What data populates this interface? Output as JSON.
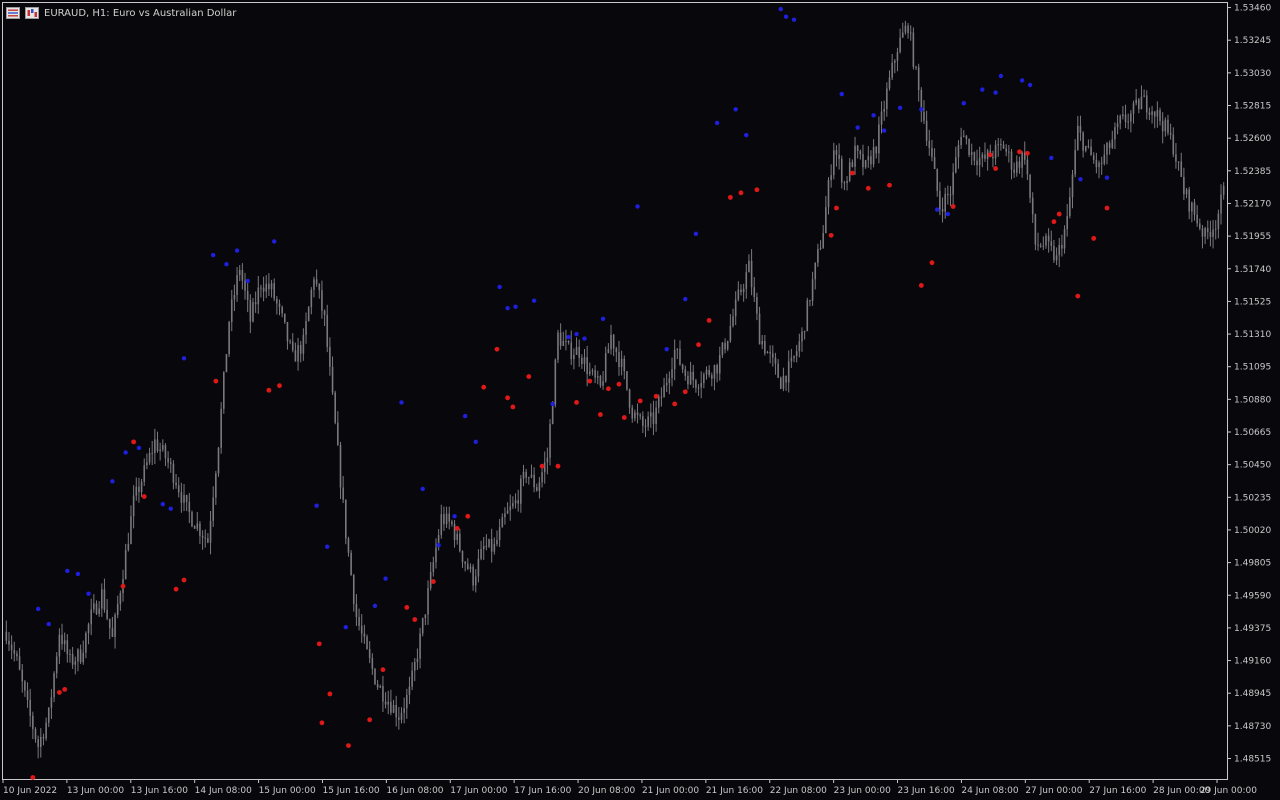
{
  "window": {
    "title": "EURAUD, H1:  Euro vs Australian Dollar",
    "icons": [
      "menu-grid-icon",
      "chart-mode-icon"
    ]
  },
  "colors": {
    "background": "#08080c",
    "candle": "#7a7a7e",
    "frame": "#c8c8c8",
    "up_marker": "#1f1fe0",
    "down_marker": "#e01818",
    "axis_text": "#c8c8c8"
  },
  "chart_data": {
    "type": "candlestick",
    "symbol": "EURAUD",
    "timeframe": "H1",
    "y_ticks": [
      "1.53460",
      "1.53245",
      "1.53030",
      "1.52815",
      "1.52600",
      "1.52385",
      "1.52170",
      "1.51955",
      "1.51740",
      "1.51525",
      "1.51310",
      "1.51095",
      "1.50880",
      "1.50665",
      "1.50450",
      "1.50235",
      "1.50020",
      "1.49805",
      "1.49590",
      "1.49375",
      "1.49160",
      "1.48945",
      "1.48730",
      "1.48515"
    ],
    "ylim": [
      1.4838,
      1.5349
    ],
    "x_ticks": [
      "10 Jun 2022",
      "13 Jun 00:00",
      "13 Jun 16:00",
      "14 Jun 08:00",
      "15 Jun 00:00",
      "15 Jun 16:00",
      "16 Jun 08:00",
      "17 Jun 00:00",
      "17 Jun 16:00",
      "20 Jun 08:00",
      "21 Jun 00:00",
      "21 Jun 16:00",
      "22 Jun 08:00",
      "23 Jun 00:00",
      "23 Jun 16:00",
      "24 Jun 08:00",
      "27 Jun 00:00",
      "27 Jun 16:00",
      "28 Jun 00:00",
      "29 Jun 00:00"
    ],
    "price_path": [
      [
        0,
        1.4935
      ],
      [
        4,
        1.4915
      ],
      [
        8,
        1.4885
      ],
      [
        12,
        1.486
      ],
      [
        16,
        1.488
      ],
      [
        20,
        1.4935
      ],
      [
        24,
        1.4915
      ],
      [
        28,
        1.492
      ],
      [
        32,
        1.4945
      ],
      [
        36,
        1.496
      ],
      [
        40,
        1.493
      ],
      [
        44,
        1.4975
      ],
      [
        48,
        1.502
      ],
      [
        52,
        1.504
      ],
      [
        56,
        1.506
      ],
      [
        60,
        1.505
      ],
      [
        64,
        1.5035
      ],
      [
        68,
        1.5015
      ],
      [
        72,
        1.5005
      ],
      [
        76,
        1.4995
      ],
      [
        80,
        1.506
      ],
      [
        84,
        1.514
      ],
      [
        88,
        1.5175
      ],
      [
        92,
        1.514
      ],
      [
        96,
        1.5165
      ],
      [
        100,
        1.516
      ],
      [
        104,
        1.514
      ],
      [
        108,
        1.5115
      ],
      [
        112,
        1.5125
      ],
      [
        116,
        1.517
      ],
      [
        120,
        1.514
      ],
      [
        124,
        1.507
      ],
      [
        128,
        1.5
      ],
      [
        132,
        1.4945
      ],
      [
        136,
        1.492
      ],
      [
        140,
        1.49
      ],
      [
        144,
        1.489
      ],
      [
        148,
        1.488
      ],
      [
        152,
        1.4895
      ],
      [
        156,
        1.493
      ],
      [
        160,
        1.497
      ],
      [
        164,
        1.501
      ],
      [
        168,
        1.5005
      ],
      [
        172,
        1.4985
      ],
      [
        176,
        1.497
      ],
      [
        180,
        1.499
      ],
      [
        184,
        1.499
      ],
      [
        188,
        1.501
      ],
      [
        192,
        1.502
      ],
      [
        196,
        1.504
      ],
      [
        200,
        1.503
      ],
      [
        204,
        1.505
      ],
      [
        208,
        1.513
      ],
      [
        212,
        1.512
      ],
      [
        216,
        1.512
      ],
      [
        220,
        1.5105
      ],
      [
        224,
        1.5095
      ],
      [
        228,
        1.513
      ],
      [
        232,
        1.511
      ],
      [
        236,
        1.508
      ],
      [
        240,
        1.507
      ],
      [
        244,
        1.5075
      ],
      [
        248,
        1.5095
      ],
      [
        252,
        1.512
      ],
      [
        256,
        1.5105
      ],
      [
        260,
        1.51
      ],
      [
        264,
        1.5105
      ],
      [
        268,
        1.511
      ],
      [
        272,
        1.513
      ],
      [
        276,
        1.5155
      ],
      [
        280,
        1.5175
      ],
      [
        284,
        1.513
      ],
      [
        288,
        1.5115
      ],
      [
        292,
        1.51
      ],
      [
        296,
        1.511
      ],
      [
        300,
        1.513
      ],
      [
        304,
        1.5165
      ],
      [
        308,
        1.52
      ],
      [
        312,
        1.5255
      ],
      [
        316,
        1.523
      ],
      [
        320,
        1.525
      ],
      [
        324,
        1.524
      ],
      [
        328,
        1.5255
      ],
      [
        332,
        1.529
      ],
      [
        336,
        1.532
      ],
      [
        340,
        1.5335
      ],
      [
        344,
        1.529
      ],
      [
        348,
        1.5255
      ],
      [
        352,
        1.5215
      ],
      [
        356,
        1.5225
      ],
      [
        360,
        1.5265
      ],
      [
        364,
        1.525
      ],
      [
        368,
        1.5245
      ],
      [
        372,
        1.525
      ],
      [
        376,
        1.5255
      ],
      [
        380,
        1.524
      ],
      [
        384,
        1.525
      ],
      [
        388,
        1.519
      ],
      [
        392,
        1.519
      ],
      [
        396,
        1.518
      ],
      [
        400,
        1.5205
      ],
      [
        404,
        1.5265
      ],
      [
        408,
        1.525
      ],
      [
        412,
        1.524
      ],
      [
        416,
        1.5255
      ],
      [
        420,
        1.527
      ],
      [
        424,
        1.5275
      ],
      [
        428,
        1.5285
      ],
      [
        432,
        1.528
      ],
      [
        436,
        1.527
      ],
      [
        440,
        1.5255
      ],
      [
        444,
        1.5225
      ],
      [
        448,
        1.521
      ],
      [
        452,
        1.5195
      ],
      [
        456,
        1.5205
      ],
      [
        460,
        1.523
      ],
      [
        462,
        1.5235
      ]
    ],
    "n_candles": 460,
    "markers": {
      "up": [
        [
          12,
          1.495
        ],
        [
          16,
          1.494
        ],
        [
          23,
          1.4975
        ],
        [
          27,
          1.4973
        ],
        [
          31,
          1.496
        ],
        [
          40,
          1.5034
        ],
        [
          45,
          1.5053
        ],
        [
          50,
          1.5056
        ],
        [
          59,
          1.5019
        ],
        [
          62,
          1.5016
        ],
        [
          67,
          1.5115
        ],
        [
          78,
          1.5183
        ],
        [
          83,
          1.5177
        ],
        [
          87,
          1.5186
        ],
        [
          91,
          1.5166
        ],
        [
          101,
          1.5192
        ],
        [
          117,
          1.5018
        ],
        [
          121,
          1.4991
        ],
        [
          128,
          1.4938
        ],
        [
          139,
          1.4952
        ],
        [
          143,
          1.497
        ],
        [
          149,
          1.5086
        ],
        [
          157,
          1.5029
        ],
        [
          163,
          1.4992
        ],
        [
          169,
          1.5011
        ],
        [
          173,
          1.5077
        ],
        [
          177,
          1.506
        ],
        [
          186,
          1.5162
        ],
        [
          189,
          1.5148
        ],
        [
          192,
          1.5149
        ],
        [
          199,
          1.5153
        ],
        [
          206,
          1.5085
        ],
        [
          212,
          1.5129
        ],
        [
          215,
          1.5131
        ],
        [
          218,
          1.5128
        ],
        [
          225,
          1.5141
        ],
        [
          238,
          1.5215
        ],
        [
          249,
          1.5121
        ],
        [
          256,
          1.5154
        ],
        [
          260,
          1.5197
        ],
        [
          268,
          1.527
        ],
        [
          275,
          1.5279
        ],
        [
          279,
          1.5262
        ],
        [
          292,
          1.5345
        ],
        [
          294,
          1.534
        ],
        [
          297,
          1.5338
        ],
        [
          315,
          1.5289
        ],
        [
          321,
          1.5267
        ],
        [
          327,
          1.5275
        ],
        [
          331,
          1.5265
        ],
        [
          337,
          1.528
        ],
        [
          345,
          1.5279
        ],
        [
          351,
          1.5213
        ],
        [
          355,
          1.521
        ],
        [
          361,
          1.5283
        ],
        [
          368,
          1.5292
        ],
        [
          373,
          1.529
        ],
        [
          375,
          1.5301
        ],
        [
          383,
          1.5298
        ],
        [
          386,
          1.5295
        ],
        [
          394,
          1.5247
        ],
        [
          405,
          1.5233
        ],
        [
          415,
          1.5234
        ]
      ],
      "down": [
        [
          10,
          1.4839
        ],
        [
          20,
          1.4895
        ],
        [
          22,
          1.4897
        ],
        [
          44,
          1.4965
        ],
        [
          48,
          1.506
        ],
        [
          52,
          1.5024
        ],
        [
          64,
          1.4963
        ],
        [
          67,
          1.4969
        ],
        [
          79,
          1.51
        ],
        [
          99,
          1.5094
        ],
        [
          103,
          1.5097
        ],
        [
          118,
          1.4927
        ],
        [
          119,
          1.4875
        ],
        [
          122,
          1.4894
        ],
        [
          129,
          1.486
        ],
        [
          137,
          1.4877
        ],
        [
          142,
          1.491
        ],
        [
          151,
          1.4951
        ],
        [
          154,
          1.4943
        ],
        [
          161,
          1.4968
        ],
        [
          170,
          1.5003
        ],
        [
          174,
          1.5011
        ],
        [
          180,
          1.5096
        ],
        [
          185,
          1.5121
        ],
        [
          189,
          1.5089
        ],
        [
          191,
          1.5083
        ],
        [
          197,
          1.5103
        ],
        [
          202,
          1.5044
        ],
        [
          208,
          1.5044
        ],
        [
          215,
          1.5086
        ],
        [
          220,
          1.51
        ],
        [
          224,
          1.5078
        ],
        [
          227,
          1.5095
        ],
        [
          231,
          1.5098
        ],
        [
          233,
          1.5076
        ],
        [
          239,
          1.5087
        ],
        [
          245,
          1.509
        ],
        [
          252,
          1.5085
        ],
        [
          256,
          1.5093
        ],
        [
          261,
          1.5124
        ],
        [
          265,
          1.514
        ],
        [
          273,
          1.5221
        ],
        [
          277,
          1.5224
        ],
        [
          283,
          1.5226
        ],
        [
          311,
          1.5196
        ],
        [
          313,
          1.5214
        ],
        [
          319,
          1.5237
        ],
        [
          325,
          1.5227
        ],
        [
          333,
          1.5229
        ],
        [
          345,
          1.5163
        ],
        [
          349,
          1.5178
        ],
        [
          357,
          1.5215
        ],
        [
          371,
          1.5249
        ],
        [
          373,
          1.524
        ],
        [
          382,
          1.5251
        ],
        [
          385,
          1.525
        ],
        [
          395,
          1.5205
        ],
        [
          397,
          1.521
        ],
        [
          404,
          1.5156
        ],
        [
          410,
          1.5194
        ],
        [
          415,
          1.5214
        ]
      ]
    }
  }
}
